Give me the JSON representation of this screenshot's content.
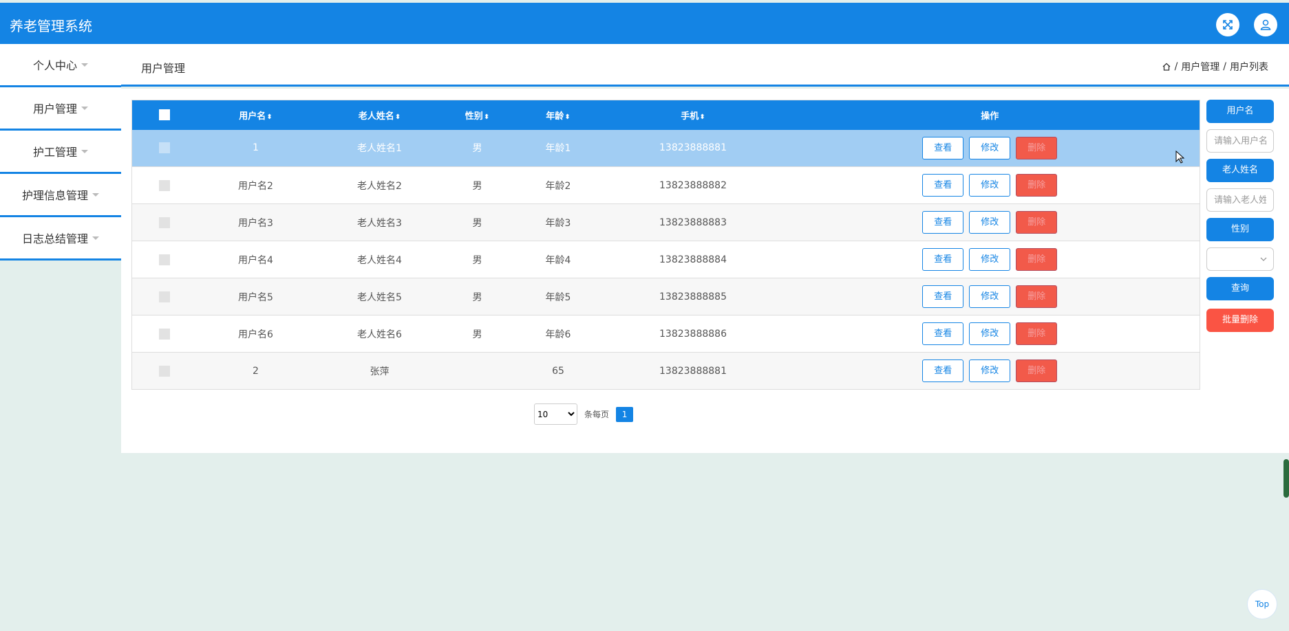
{
  "app": {
    "title": "养老管理系统"
  },
  "header_icons": [
    "fullscreen-icon",
    "user-icon"
  ],
  "sidebar": {
    "items": [
      {
        "label": "个人中心"
      },
      {
        "label": "用户管理"
      },
      {
        "label": "护工管理"
      },
      {
        "label": "护理信息管理"
      },
      {
        "label": "日志总结管理"
      }
    ]
  },
  "page": {
    "title": "用户管理",
    "breadcrumb": [
      "用户管理",
      "用户列表"
    ],
    "breadcrumb_sep": "/"
  },
  "table": {
    "columns": [
      "用户名",
      "老人姓名",
      "性别",
      "年龄",
      "手机",
      "操作"
    ],
    "sort_icon": "⬍",
    "rows": [
      {
        "username": "1",
        "elder_name": "老人姓名1",
        "gender": "男",
        "age": "年龄1",
        "phone": "13823888881"
      },
      {
        "username": "用户名2",
        "elder_name": "老人姓名2",
        "gender": "男",
        "age": "年龄2",
        "phone": "13823888882"
      },
      {
        "username": "用户名3",
        "elder_name": "老人姓名3",
        "gender": "男",
        "age": "年龄3",
        "phone": "13823888883"
      },
      {
        "username": "用户名4",
        "elder_name": "老人姓名4",
        "gender": "男",
        "age": "年龄4",
        "phone": "13823888884"
      },
      {
        "username": "用户名5",
        "elder_name": "老人姓名5",
        "gender": "男",
        "age": "年龄5",
        "phone": "13823888885"
      },
      {
        "username": "用户名6",
        "elder_name": "老人姓名6",
        "gender": "男",
        "age": "年龄6",
        "phone": "13823888886"
      },
      {
        "username": "2",
        "elder_name": "张萍",
        "gender": "",
        "age": "65",
        "phone": "13823888881"
      }
    ],
    "actions": {
      "view": "查看",
      "edit": "修改",
      "delete": "删除"
    }
  },
  "pager": {
    "page_size": "10",
    "page_size_options": [
      "10"
    ],
    "per_page_label": "条每页",
    "current_page": "1"
  },
  "filter": {
    "username_label": "用户名",
    "username_placeholder": "请输入用户名",
    "elder_label": "老人姓名",
    "elder_placeholder": "请输入老人姓名",
    "gender_label": "性别",
    "gender_value": "",
    "query_label": "查询",
    "batch_delete_label": "批量删除"
  },
  "back_to_top": "Top",
  "colors": {
    "primary": "#1484e4",
    "danger": "#fa5444",
    "background": "#e3efec",
    "highlight_row": "#a1cdf3"
  }
}
